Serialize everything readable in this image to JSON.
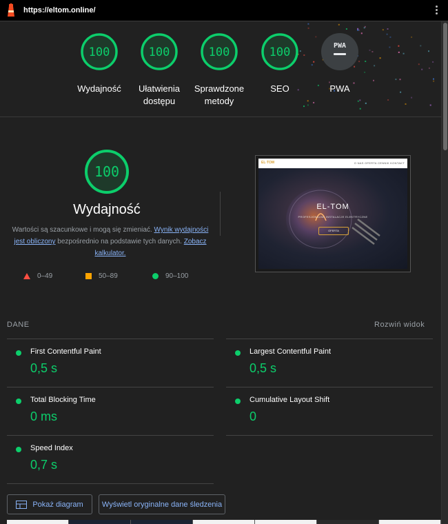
{
  "browser": {
    "url": "https://eltom.online/"
  },
  "summary_gauges": [
    {
      "score": "100",
      "label": "Wydajność"
    },
    {
      "score": "100",
      "label": "Ułatwienia dostępu"
    },
    {
      "score": "100",
      "label": "Sprawdzone metody"
    },
    {
      "score": "100",
      "label": "SEO"
    },
    {
      "score": "PWA",
      "label": "PWA"
    }
  ],
  "performance": {
    "score": "100",
    "title": "Wydajność",
    "desc_prefix": "Wartości są szacunkowe i mogą się zmieniać. ",
    "desc_link1": "Wynik wydajności jest obliczony",
    "desc_middle": " bezpośrednio na podstawie tych danych. ",
    "desc_link2": "Zobacz kalkulator.",
    "legend": [
      {
        "range": "0–49",
        "icon": "red-triangle"
      },
      {
        "range": "50–89",
        "icon": "orange-square"
      },
      {
        "range": "90–100",
        "icon": "green-circle"
      }
    ]
  },
  "screenshot": {
    "logo": "EL·TOM",
    "nav": "O NAS   OFERTA   CENNIK   KONTAKT",
    "hero_title": "EL-TOM",
    "hero_subtitle": "PROFESJONALNE INSTALACJE ELEKTRYCZNE",
    "hero_button": "OFERTA"
  },
  "metrics_section": {
    "heading": "DANE",
    "expand_label": "Rozwiń widok",
    "items": [
      {
        "name": "First Contentful Paint",
        "value": "0,5 s"
      },
      {
        "name": "Largest Contentful Paint",
        "value": "0,5 s"
      },
      {
        "name": "Total Blocking Time",
        "value": "0 ms"
      },
      {
        "name": "Cumulative Layout Shift",
        "value": "0"
      },
      {
        "name": "Speed Index",
        "value": "0,7 s"
      }
    ]
  },
  "buttons": {
    "treemap": "Pokaż diagram",
    "trace": "Wyświetl oryginalne dane śledzenia"
  },
  "colors": {
    "pass": "#0cce6b",
    "fail": "#ff4e42",
    "average": "#ffa400",
    "link": "#8ab4f8",
    "background": "#212121"
  }
}
